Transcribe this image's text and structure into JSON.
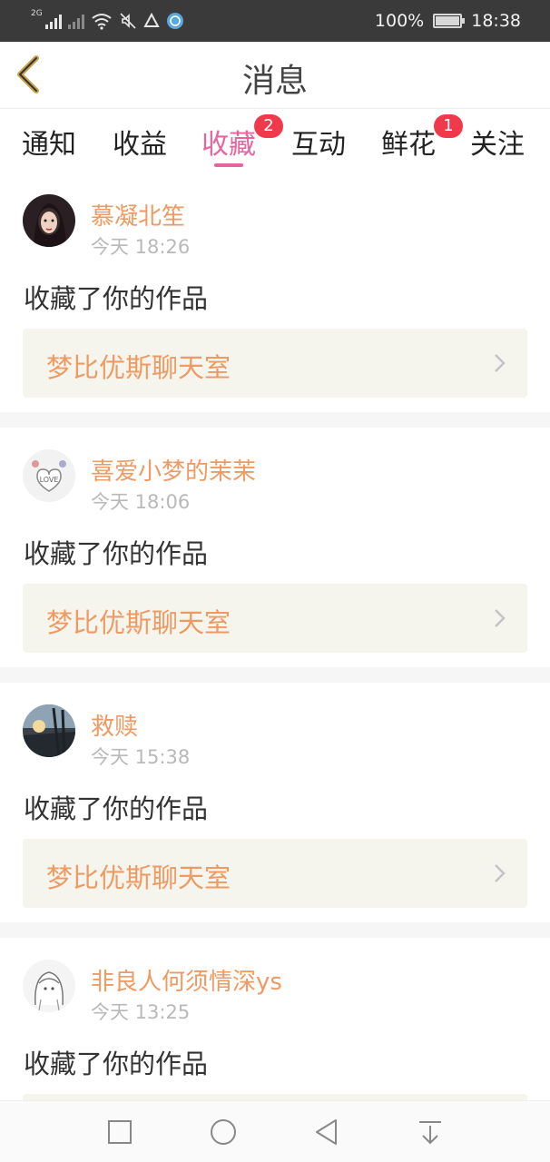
{
  "status_bar": {
    "network_label": "2G",
    "battery_percent": "100%",
    "time": "18:38",
    "icons": [
      "signal-icon",
      "signal-no-sim-icon",
      "wifi-icon",
      "mute-icon",
      "alert-icon",
      "compass-app-icon",
      "battery-icon"
    ]
  },
  "header": {
    "title": "消息",
    "back_icon": "chevron-left-icon"
  },
  "tabs": [
    {
      "label": "通知",
      "badge": ""
    },
    {
      "label": "收益",
      "badge": ""
    },
    {
      "label": "收藏",
      "badge": "2",
      "active": true
    },
    {
      "label": "互动",
      "badge": ""
    },
    {
      "label": "鲜花",
      "badge": "1"
    },
    {
      "label": "关注",
      "badge": ""
    }
  ],
  "feed": [
    {
      "user": "慕凝北笙",
      "time": "今天 18:26",
      "action": "收藏了你的作品",
      "work_title": "梦比优斯聊天室"
    },
    {
      "user": "喜爱小梦的茉茉",
      "time": "今天 18:06",
      "action": "收藏了你的作品",
      "work_title": "梦比优斯聊天室"
    },
    {
      "user": "救赎",
      "time": "今天 15:38",
      "action": "收藏了你的作品",
      "work_title": "梦比优斯聊天室"
    },
    {
      "user": "非良人何须情深ys",
      "time": "今天 13:25",
      "action": "收藏了你的作品",
      "work_title": ""
    }
  ],
  "navbar": {
    "buttons": [
      "recent-apps-square-icon",
      "home-circle-icon",
      "back-triangle-icon",
      "notification-pull-down-icon"
    ]
  },
  "colors": {
    "accent_pink": "#e6659f",
    "username_orange": "#ee9a62",
    "badge_red": "#f0394a",
    "back_arrow_gold": "#c8a24a",
    "work_card_bg": "#f5f5ee"
  }
}
